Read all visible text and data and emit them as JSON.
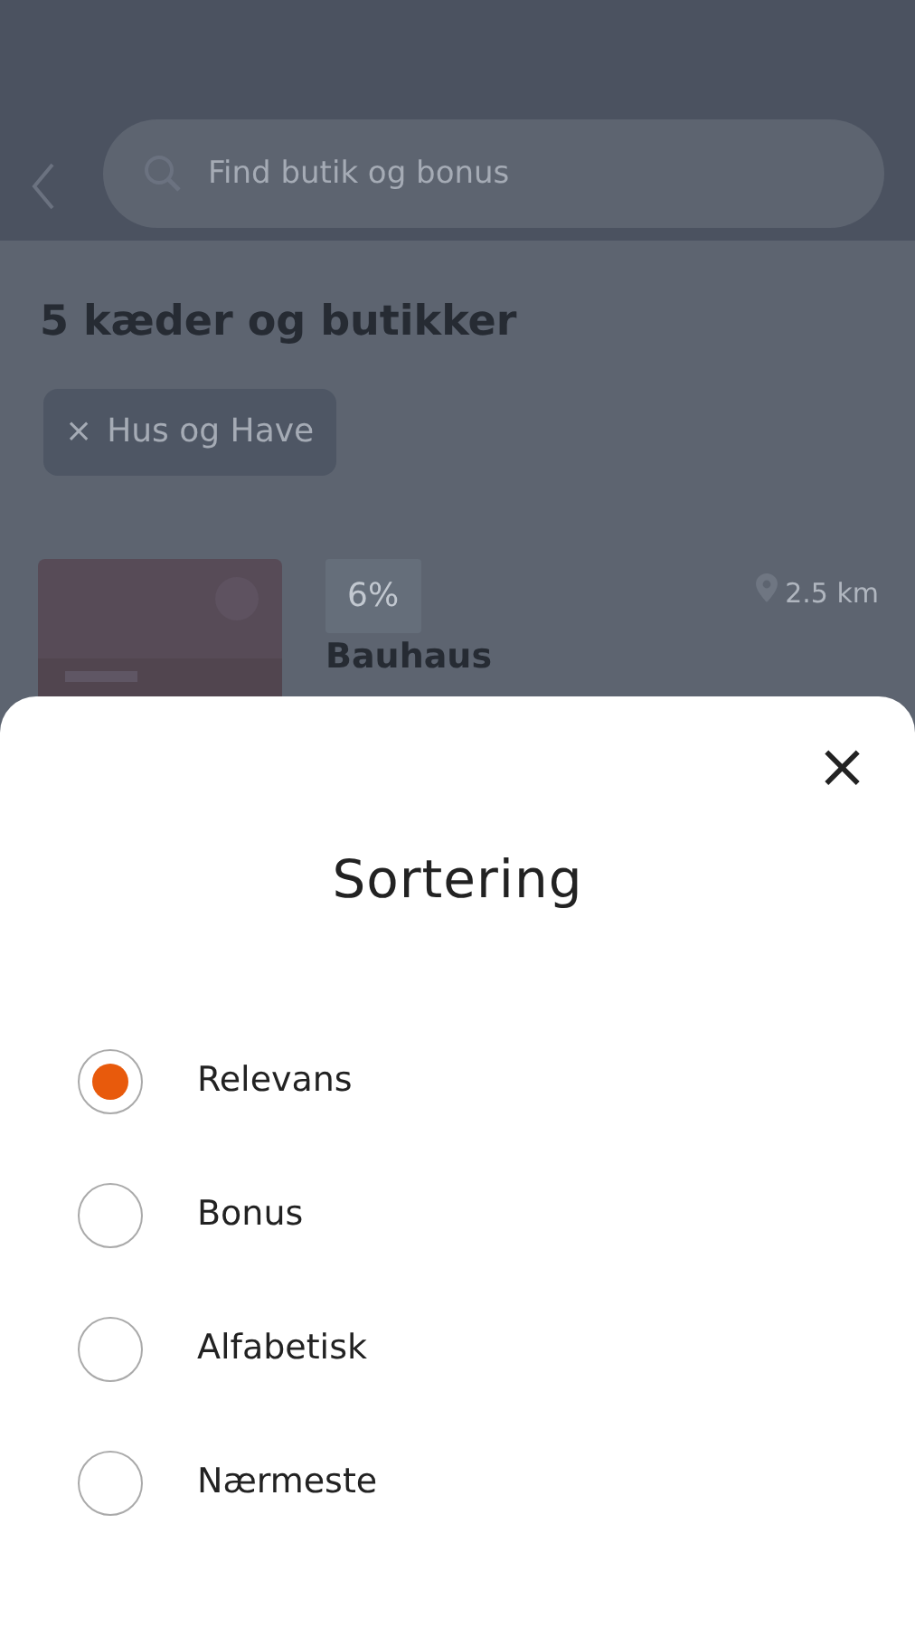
{
  "search": {
    "placeholder": "Find butik og bonus"
  },
  "result_heading": "5 kæder og butikker",
  "filter_chips": [
    {
      "icon": "×",
      "label": "Hus og Have"
    }
  ],
  "stores": [
    {
      "bonus": "6%",
      "name": "Bauhaus",
      "distance": "2.5 km"
    }
  ],
  "sort_sheet": {
    "title": "Sortering",
    "close": "×",
    "options": [
      {
        "label": "Relevans",
        "selected": true
      },
      {
        "label": "Bonus",
        "selected": false
      },
      {
        "label": "Alfabetisk",
        "selected": false
      },
      {
        "label": "Nærmeste",
        "selected": false
      }
    ]
  }
}
